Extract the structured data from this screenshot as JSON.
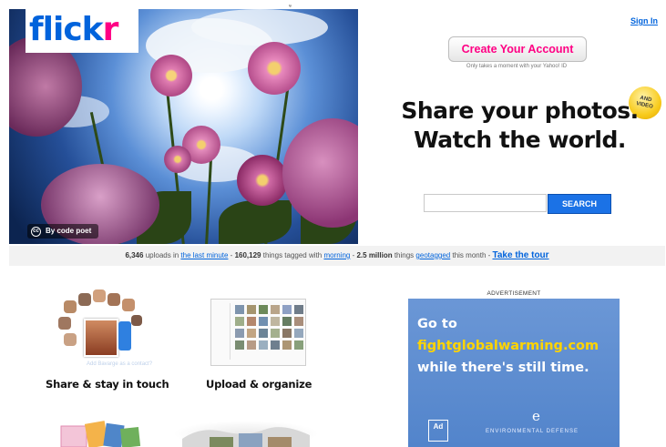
{
  "page": {
    "stray_glyph": "ู"
  },
  "header": {
    "logo_part1": "flick",
    "logo_part2": "r",
    "signin": "Sign In"
  },
  "hero": {
    "credit": "By code poet"
  },
  "signup": {
    "create_label": "Create Your Account",
    "create_sub": "Only takes a moment with your Yahoo! ID",
    "badge_line1": "AND",
    "badge_line2": "VIDEO",
    "tagline_line1": "Share your photos.",
    "tagline_line2": "Watch the world.",
    "search_button": "SEARCH",
    "search_value": ""
  },
  "stats": {
    "uploads": "6,346",
    "uploads_text": "uploads in",
    "last_minute": "the last minute",
    "tagged_count": "160,129",
    "tagged_text": "things tagged with",
    "tag": "morning",
    "geotag_count": "2.5 million",
    "geotag_text": "things",
    "geotagged": "geotagged",
    "month_text": "this month",
    "tour": "Take the tour"
  },
  "features": {
    "share_label": "Share & stay in touch",
    "share_hint": "Add Bavarge as a contact?",
    "upload_label": "Upload & organize"
  },
  "ad": {
    "label": "ADVERTISEMENT",
    "line1": "Go to",
    "line2": "fightglobalwarming.com",
    "line3": "while there's still time.",
    "council_logo": "Ad",
    "env_logo": "e",
    "env_org": "ENVIRONMENTAL DEFENSE"
  },
  "colors": {
    "flickr_blue": "#0063dc",
    "flickr_pink": "#ff0084",
    "ad_bg": "#5b8bd1",
    "ad_highlight": "#ffd400"
  }
}
